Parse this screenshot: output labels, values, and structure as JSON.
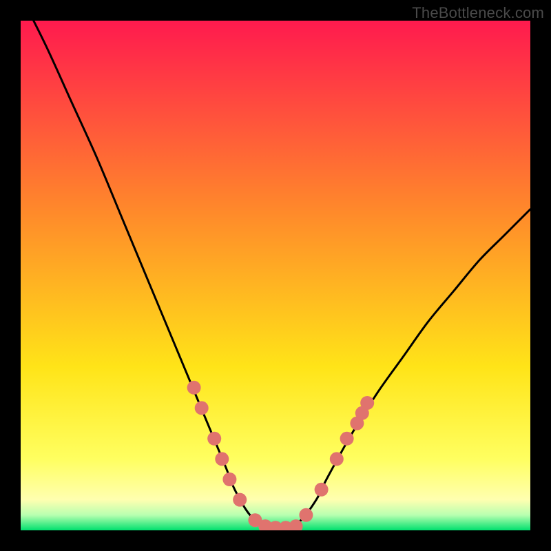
{
  "watermark": "TheBottleneck.com",
  "chart_data": {
    "type": "line",
    "title": "",
    "xlabel": "",
    "ylabel": "",
    "xlim": [
      0,
      100
    ],
    "ylim": [
      0,
      100
    ],
    "grid": false,
    "legend": false,
    "curve": {
      "name": "bottleneck-curve",
      "x": [
        0,
        5,
        10,
        15,
        20,
        25,
        30,
        35,
        40,
        42,
        45,
        48,
        50,
        52,
        55,
        58,
        60,
        65,
        70,
        75,
        80,
        85,
        90,
        95,
        100
      ],
      "y": [
        105,
        95,
        84,
        73,
        61,
        49,
        37,
        25,
        13,
        8,
        3,
        1,
        0,
        0,
        2,
        6,
        10,
        19,
        27,
        34,
        41,
        47,
        53,
        58,
        63
      ]
    },
    "markers": {
      "name": "highlight-dots",
      "color_hex": "#e0736e",
      "radius_px": 10,
      "points": [
        {
          "x": 34,
          "y": 28
        },
        {
          "x": 35.5,
          "y": 24
        },
        {
          "x": 38,
          "y": 18
        },
        {
          "x": 39.5,
          "y": 14
        },
        {
          "x": 41,
          "y": 10
        },
        {
          "x": 43,
          "y": 6
        },
        {
          "x": 46,
          "y": 2
        },
        {
          "x": 48,
          "y": 0.8
        },
        {
          "x": 50,
          "y": 0.5
        },
        {
          "x": 52,
          "y": 0.5
        },
        {
          "x": 54,
          "y": 0.8
        },
        {
          "x": 56,
          "y": 3
        },
        {
          "x": 59,
          "y": 8
        },
        {
          "x": 62,
          "y": 14
        },
        {
          "x": 64,
          "y": 18
        },
        {
          "x": 66,
          "y": 21
        },
        {
          "x": 67,
          "y": 23
        },
        {
          "x": 68,
          "y": 25
        }
      ]
    },
    "gradient_bg": {
      "top_hex": "#ff1a4e",
      "mid1_hex": "#ff8b2a",
      "mid2_hex": "#ffe418",
      "pale_hex": "#ffffb0",
      "base_hex": "#00e06e"
    }
  }
}
